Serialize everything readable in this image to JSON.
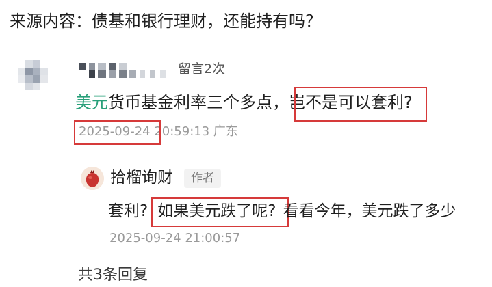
{
  "header": {
    "source_text": "来源内容：债基和银行理财，还能持有吗？"
  },
  "comment": {
    "message_count_text": "留言2次",
    "text_highlight": "美元",
    "text_middle": "货币基金利率三个多点，",
    "text_boxed": "岂不是可以套利?",
    "date": "2025-09-24",
    "time": " 20:59:13",
    "location": " 广东"
  },
  "reply": {
    "author_name": "拾榴询财",
    "author_badge": "作者",
    "text_before": "套利?",
    "text_boxed": "如果美元跌了呢?",
    "text_after": "看看今年，美元跌了多少",
    "datetime": "2025-09-24 21:00:57"
  },
  "footer": {
    "total_replies": "共3条回复"
  },
  "colors": {
    "accent_green": "#29a07a",
    "highlight_red": "#d63a3a",
    "meta_gray": "#9a9a9a"
  }
}
